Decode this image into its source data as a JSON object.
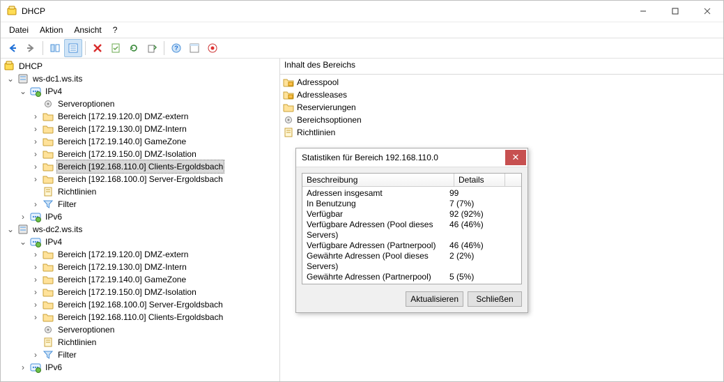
{
  "window": {
    "title": "DHCP"
  },
  "menu": {
    "file": "Datei",
    "action": "Aktion",
    "view": "Ansicht",
    "help": "?"
  },
  "tree": {
    "root": "DHCP",
    "servers": [
      {
        "name": "ws-dc1.ws.its",
        "ipv4": {
          "label": "IPv4",
          "serveroptions": "Serveroptionen",
          "scopes": [
            "Bereich [172.19.120.0] DMZ-extern",
            "Bereich [172.19.130.0] DMZ-Intern",
            "Bereich [172.19.140.0] GameZone",
            "Bereich [172.19.150.0] DMZ-Isolation",
            "Bereich [192.168.110.0] Clients-Ergoldsbach",
            "Bereich [192.168.100.0] Server-Ergoldsbach"
          ],
          "policies": "Richtlinien",
          "filter": "Filter"
        },
        "ipv6": {
          "label": "IPv6"
        }
      },
      {
        "name": "ws-dc2.ws.its",
        "ipv4": {
          "label": "IPv4",
          "scopes": [
            "Bereich [172.19.120.0] DMZ-extern",
            "Bereich [172.19.130.0] DMZ-Intern",
            "Bereich [172.19.140.0] GameZone",
            "Bereich [172.19.150.0] DMZ-Isolation",
            "Bereich [192.168.100.0] Server-Ergoldsbach",
            "Bereich [192.168.110.0] Clients-Ergoldsbach"
          ],
          "serveroptions": "Serveroptionen",
          "policies": "Richtlinien",
          "filter": "Filter"
        },
        "ipv6": {
          "label": "IPv6"
        }
      }
    ]
  },
  "right": {
    "header": "Inhalt des Bereichs",
    "items": [
      "Adresspool",
      "Adressleases",
      "Reservierungen",
      "Bereichsoptionen",
      "Richtlinien"
    ]
  },
  "dialog": {
    "title": "Statistiken für Bereich 192.168.110.0",
    "col1": "Beschreibung",
    "col2": "Details",
    "rows": [
      {
        "d": "Adressen insgesamt",
        "v": "99"
      },
      {
        "d": "In Benutzung",
        "v": "7 (7%)"
      },
      {
        "d": "Verfügbar",
        "v": "92 (92%)"
      },
      {
        "d": "Verfügbare Adressen (Pool dieses Servers)",
        "v": "46 (46%)"
      },
      {
        "d": "Verfügbare Adressen (Partnerpool)",
        "v": "46 (46%)"
      },
      {
        "d": "Gewährte Adressen (Pool dieses Servers)",
        "v": "2 (2%)"
      },
      {
        "d": "Gewährte Adressen (Partnerpool)",
        "v": "5 (5%)"
      }
    ],
    "refresh": "Aktualisieren",
    "close": "Schließen"
  },
  "icons": {
    "dhcp": "dhcp",
    "server": "server",
    "ipv4": "ipv4",
    "ipv6": "ipv6",
    "folder": "folder",
    "gear": "gear",
    "filter": "filter",
    "pool": "pool",
    "leases": "leases",
    "reserv": "reserv",
    "opts": "opts",
    "pol": "pol"
  }
}
